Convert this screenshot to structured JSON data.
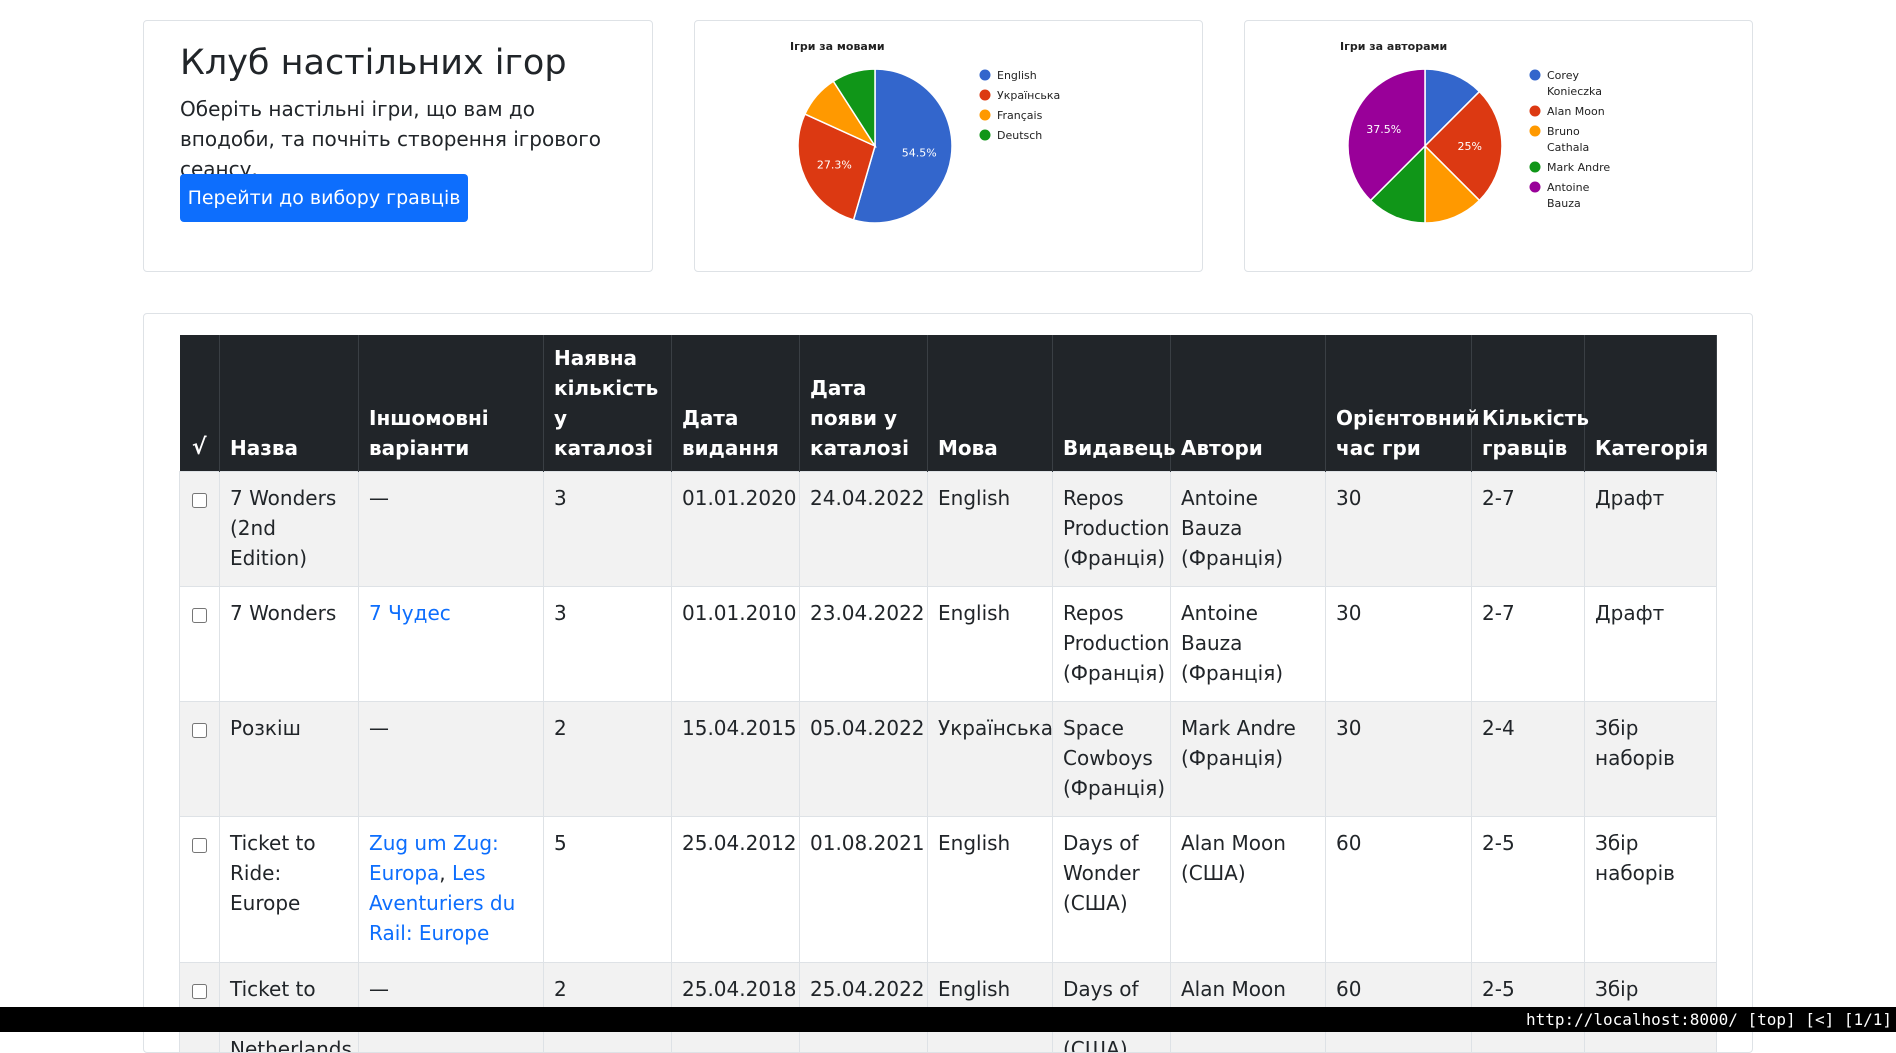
{
  "intro": {
    "title": "Клуб настільних ігор",
    "description": "Оберіть настільні ігри, що вам до вподоби, та почніть створення ігрового сеансу.",
    "button_label": "Перейти до вибору гравців",
    "button_color": "#0d6efd"
  },
  "chart_data": [
    {
      "type": "pie",
      "title": "Ігри за мовами",
      "categories": [
        "English",
        "Українська",
        "Français",
        "Deutsch"
      ],
      "values": [
        54.5,
        27.3,
        9.1,
        9.1
      ],
      "colors": [
        "#3366cc",
        "#dc3912",
        "#ff9900",
        "#109618"
      ],
      "data_labels": [
        "54.5%",
        "27.3%",
        "",
        ""
      ],
      "legend_position": "right"
    },
    {
      "type": "pie",
      "title": "Ігри за авторами",
      "categories": [
        "Corey Konieczka",
        "Alan Moon",
        "Bruno Cathala",
        "Mark Andre",
        "Antoine Bauza"
      ],
      "legend_lines": [
        [
          "Corey",
          "Konieczka"
        ],
        [
          "Alan Moon"
        ],
        [
          "Bruno",
          "Cathala"
        ],
        [
          "Mark Andre"
        ],
        [
          "Antoine",
          "Bauza"
        ]
      ],
      "values": [
        12.5,
        25,
        12.5,
        12.5,
        37.5
      ],
      "colors": [
        "#3366cc",
        "#dc3912",
        "#ff9900",
        "#109618",
        "#990099"
      ],
      "data_labels": [
        "",
        "25%",
        "",
        "",
        "37.5%"
      ],
      "legend_position": "right"
    }
  ],
  "table": {
    "header": {
      "check": "√",
      "name": "Назва",
      "variants": "Іншомовні варіанти",
      "quantity": "Наявна кількість у каталозі",
      "published": "Дата видання",
      "added": "Дата появи у каталозі",
      "language": "Мова",
      "publisher": "Видавець",
      "authors": "Автори",
      "playtime": "Орієнтовний час гри",
      "players": "Кількість гравців",
      "category": "Категорія"
    },
    "rows": [
      {
        "name": "7 Wonders (2nd Edition)",
        "variants": [],
        "variants_text": "—",
        "quantity": "3",
        "published": "01.01.2020",
        "added": "24.04.2022",
        "language": "English",
        "publisher": "Repos Production (Франція)",
        "authors": "Antoine Bauza (Франція)",
        "playtime": "30",
        "players": "2-7",
        "category": "Драфт"
      },
      {
        "name": "7 Wonders",
        "variants": [
          "7 Чудес"
        ],
        "variants_text": "",
        "quantity": "3",
        "published": "01.01.2010",
        "added": "23.04.2022",
        "language": "English",
        "publisher": "Repos Production (Франція)",
        "authors": "Antoine Bauza (Франція)",
        "playtime": "30",
        "players": "2-7",
        "category": "Драфт"
      },
      {
        "name": "Розкіш",
        "variants": [],
        "variants_text": "—",
        "quantity": "2",
        "published": "15.04.2015",
        "added": "05.04.2022",
        "language": "Українська",
        "publisher": "Space Cowboys (Франція)",
        "authors": "Mark Andre (Франція)",
        "playtime": "30",
        "players": "2-4",
        "category": "Збір наборів"
      },
      {
        "name": "Ticket to Ride: Europe",
        "variants": [
          "Zug um Zug: Europa",
          "Les Aventuriers du Rail: Europe"
        ],
        "variants_text": "",
        "quantity": "5",
        "published": "25.04.2012",
        "added": "01.08.2021",
        "language": "English",
        "publisher": "Days of Wonder (США)",
        "authors": "Alan Moon (США)",
        "playtime": "60",
        "players": "2-5",
        "category": "Збір наборів"
      },
      {
        "name": "Ticket to Ride: Netherlands",
        "variants": [],
        "variants_text": "—",
        "quantity": "2",
        "published": "25.04.2018",
        "added": "25.04.2022",
        "language": "English",
        "publisher": "Days of Wonder (США)",
        "authors": "Alan Moon (США)",
        "playtime": "60",
        "players": "2-5",
        "category": "Збір наборів"
      }
    ]
  },
  "status_bar": {
    "text": "http://localhost:8000/ [top] [<] [1/1]"
  }
}
